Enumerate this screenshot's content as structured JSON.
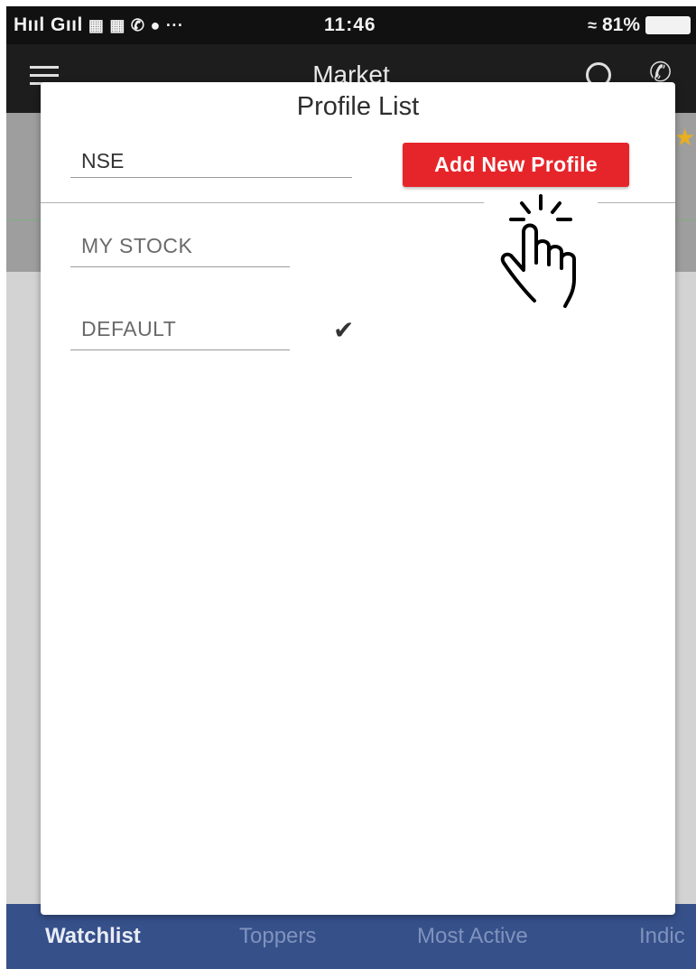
{
  "status_bar": {
    "left_text": "Hııl Gııl",
    "icons": [
      "sim-icon",
      "sim-icon",
      "whatsapp-icon",
      "chat-icon",
      "more-icon"
    ],
    "time": "11:46",
    "battery_percent": "81%"
  },
  "app_bar": {
    "title": "Market"
  },
  "dialog": {
    "title": "Profile List",
    "input_value": "NSE",
    "add_button_label": "Add New Profile",
    "profiles": [
      {
        "label": "MY STOCK",
        "selected": false
      },
      {
        "label": "DEFAULT",
        "selected": true
      }
    ]
  },
  "tabs": [
    {
      "label": "Watchlist",
      "active": true
    },
    {
      "label": "Toppers",
      "active": false
    },
    {
      "label": "Most Active",
      "active": false
    },
    {
      "label": "Indic",
      "active": false
    }
  ],
  "colors": {
    "accent": "#e6252a",
    "tab_bar": "#36508a"
  }
}
